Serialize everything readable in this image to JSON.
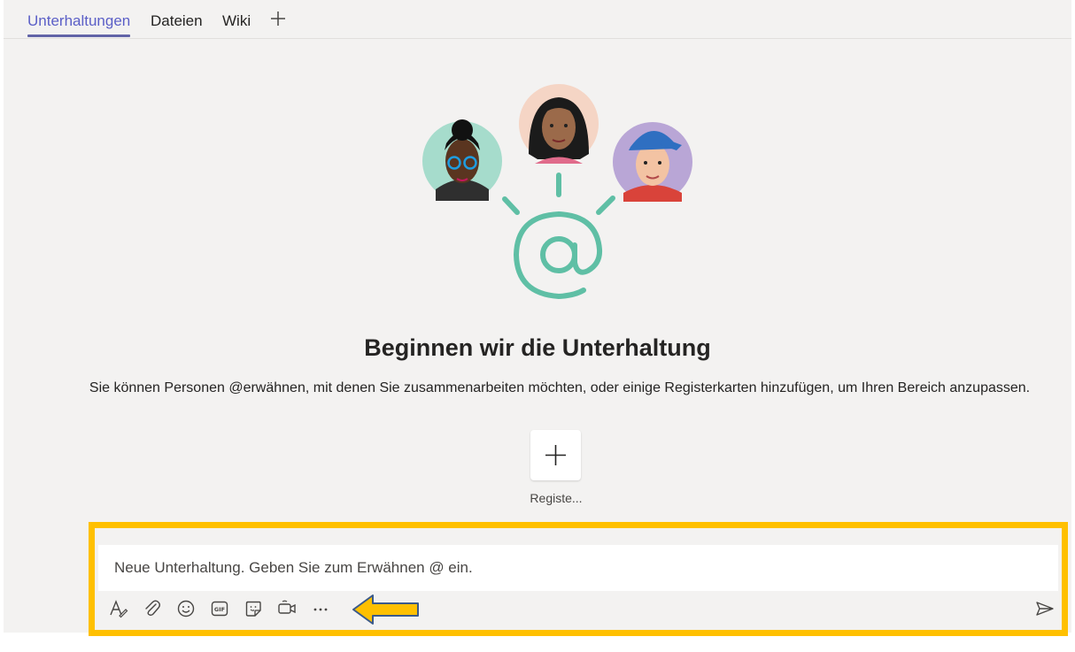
{
  "tabs": [
    {
      "label": "Unterhaltungen",
      "active": true
    },
    {
      "label": "Dateien",
      "active": false
    },
    {
      "label": "Wiki",
      "active": false
    }
  ],
  "tabs_add_icon": "plus-icon",
  "empty_state": {
    "title": "Beginnen wir die Unterhaltung",
    "subtitle": "Sie können Personen @erwähnen, mit denen Sie zusammenarbeiten möchten, oder einige Registerkarten hinzufügen, um Ihren Bereich anzupassen.",
    "add_tab_label": "Registe..."
  },
  "compose": {
    "placeholder": "Neue Unterhaltung. Geben Sie zum Erwähnen @ ein.",
    "toolbar_icons": [
      "format-icon",
      "attach-icon",
      "emoji-icon",
      "gif-icon",
      "sticker-icon",
      "meet-now-icon",
      "more-options-icon"
    ],
    "send_icon": "send-icon"
  },
  "colors": {
    "accent": "#6264a7",
    "highlight": "#ffc000",
    "at_symbol": "#5fbfa5"
  }
}
